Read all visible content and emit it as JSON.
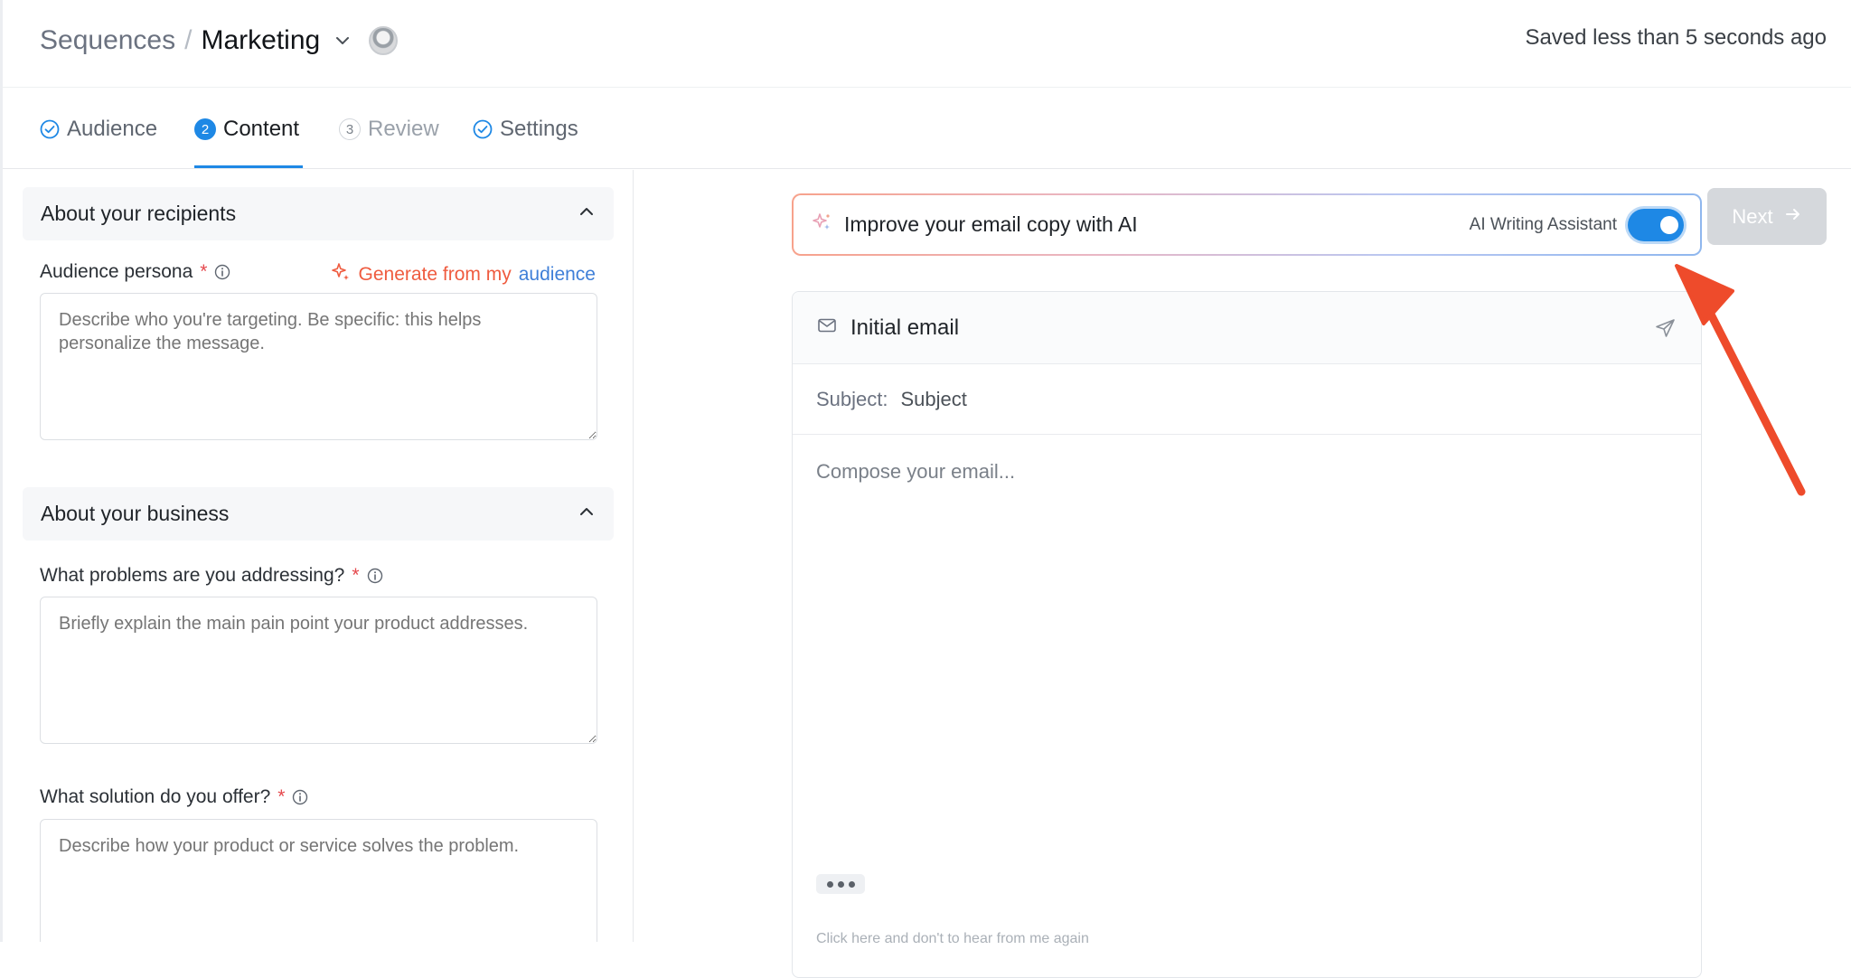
{
  "breadcrumb": {
    "root": "Sequences",
    "separator": "/",
    "current": "Marketing"
  },
  "save_status": "Saved less than 5 seconds ago",
  "steps": [
    {
      "label": "Audience",
      "state": "done"
    },
    {
      "number": "2",
      "label": "Content",
      "state": "active"
    },
    {
      "number": "3",
      "label": "Review",
      "state": "upcoming"
    },
    {
      "label": "Settings",
      "state": "done"
    }
  ],
  "next_button": {
    "label": "Next",
    "enabled": false
  },
  "recipients_section": {
    "title": "About your recipients",
    "persona_label": "Audience persona",
    "required_mark": "*",
    "generate_prefix": "Generate from my",
    "generate_suffix": "audience",
    "persona_placeholder": "Describe who you're targeting. Be specific: this helps personalize the message."
  },
  "business_section": {
    "title": "About your business",
    "problems_label": "What problems are you addressing?",
    "problems_placeholder": "Briefly explain the main pain point your product addresses.",
    "solution_label": "What solution do you offer?",
    "solution_placeholder": "Describe how your product or service solves the problem."
  },
  "ai_banner": {
    "text": "Improve your email copy with AI",
    "toggle_label": "AI Writing Assistant",
    "toggle_on": true
  },
  "email_card": {
    "title": "Initial email",
    "subject_key": "Subject:",
    "subject_value": "Subject",
    "compose_placeholder": "Compose your email...",
    "footer_text": "Click here and don't to hear from me again"
  },
  "colors": {
    "accent": "#1e88e5",
    "required": "#e5484d",
    "generate": "#ef5b3f",
    "annotation_arrow": "#ee4b2b"
  }
}
